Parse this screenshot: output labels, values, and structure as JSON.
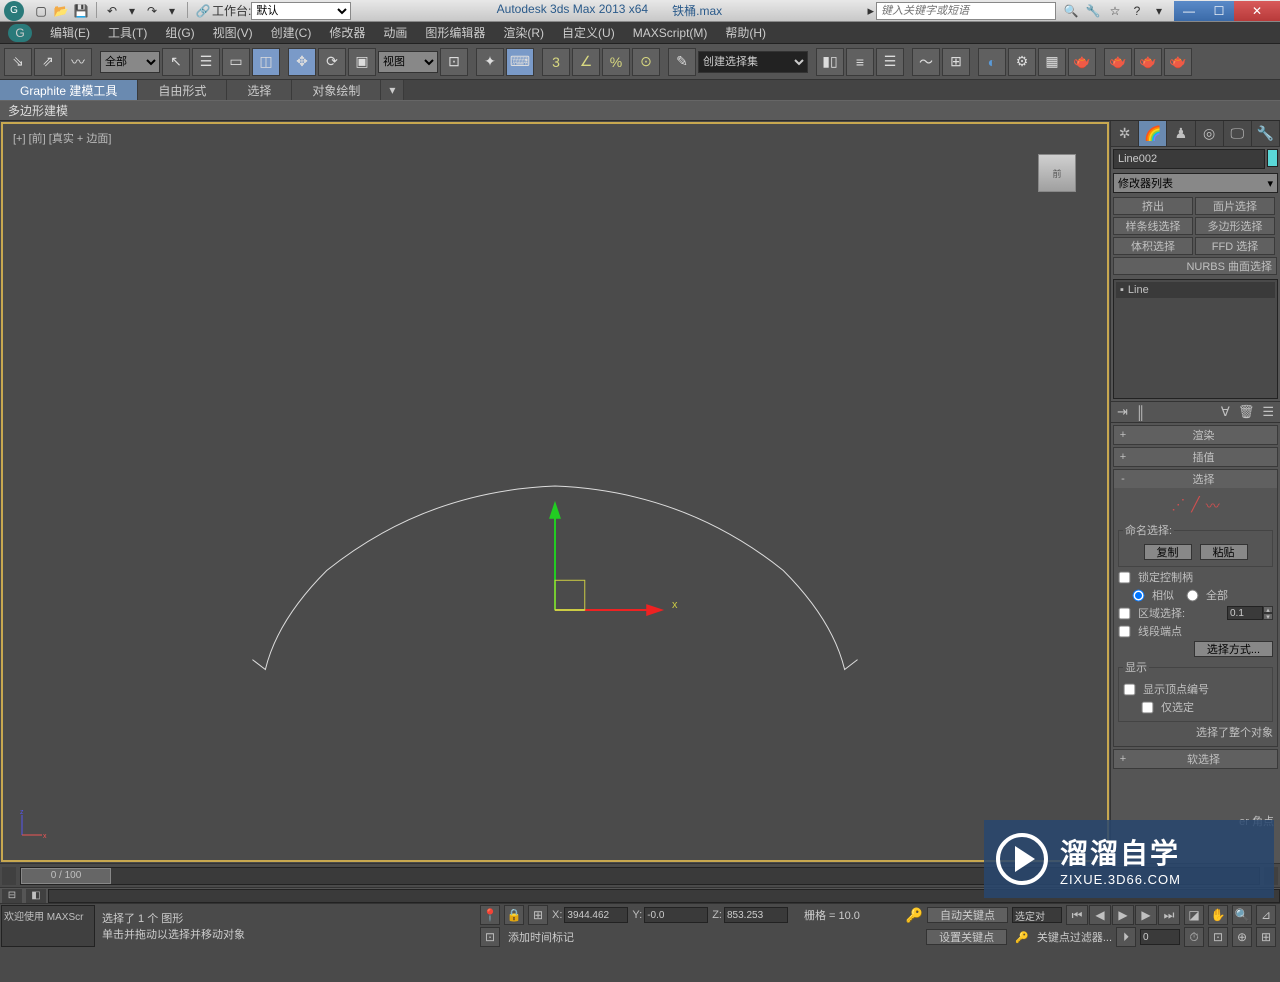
{
  "title_bar": {
    "app_title": "Autodesk 3ds Max  2013 x64",
    "file_name": "铁桶.max",
    "workspace_label": "工作台:",
    "workspace_value": "默认",
    "search_placeholder": "键入关键字或短语"
  },
  "menu": {
    "edit": "编辑(E)",
    "tools": "工具(T)",
    "group": "组(G)",
    "view": "视图(V)",
    "create": "创建(C)",
    "modifier": "修改器",
    "anim": "动画",
    "graph": "图形编辑器",
    "render": "渲染(R)",
    "custom": "自定义(U)",
    "maxscript": "MAXScript(M)",
    "help": "帮助(H)"
  },
  "toolbar": {
    "filter_all": "全部",
    "ref_coord": "视图",
    "named_sel": "创建选择集"
  },
  "ribbon": {
    "graphite": "Graphite 建模工具",
    "freeform": "自由形式",
    "selection": "选择",
    "paint": "对象绘制",
    "poly_model": "多边形建模"
  },
  "viewport": {
    "label": "[+] [前] [真实 + 边面]",
    "viewcube_face": "前",
    "x_axis": "x"
  },
  "cmd": {
    "obj_name": "Line002",
    "mod_list": "修改器列表",
    "btns": {
      "extrude": "挤出",
      "face_sel": "面片选择",
      "spline_sel": "样条线选择",
      "poly_sel": "多边形选择",
      "vol_sel": "体积选择",
      "ffd_sel": "FFD 选择",
      "nurbs": "NURBS 曲面选择"
    },
    "stack_item": "Line",
    "rollouts": {
      "render": "渲染",
      "interp": "插值",
      "selection": "选择",
      "soft_sel": "软选择"
    },
    "sel_body": {
      "named_sel": "命名选择:",
      "copy": "复制",
      "paste": "粘贴",
      "lock_handle": "锁定控制柄",
      "similar": "相似",
      "all": "全部",
      "area_sel": "区域选择:",
      "area_val": "0.1",
      "seg_end": "线段端点",
      "sel_method": "选择方式...",
      "display": "显示",
      "show_vnum": "显示顶点编号",
      "only_sel": "仅选定",
      "sel_whole": "选择了整个对象"
    },
    "geom": {
      "corner": "er 角点"
    }
  },
  "timeline": {
    "slider": "0 / 100"
  },
  "status": {
    "welcome_prompt": "欢迎使用  MAXScr",
    "msg1": "选择了 1 个 图形",
    "msg2": "单击并拖动以选择并移动对象",
    "x_label": "X:",
    "x_val": "3944.462",
    "y_label": "Y:",
    "y_val": "-0.0",
    "z_label": "Z:",
    "z_val": "853.253",
    "grid": "栅格 = 10.0",
    "add_time": "添加时间标记",
    "auto_key": "自动关键点",
    "sel_obj": "选定对",
    "set_key": "设置关键点",
    "key_filter": "关键点过滤器...",
    "frame": "0"
  },
  "watermark": {
    "big": "溜溜自学",
    "small": "ZIXUE.3D66.COM"
  }
}
